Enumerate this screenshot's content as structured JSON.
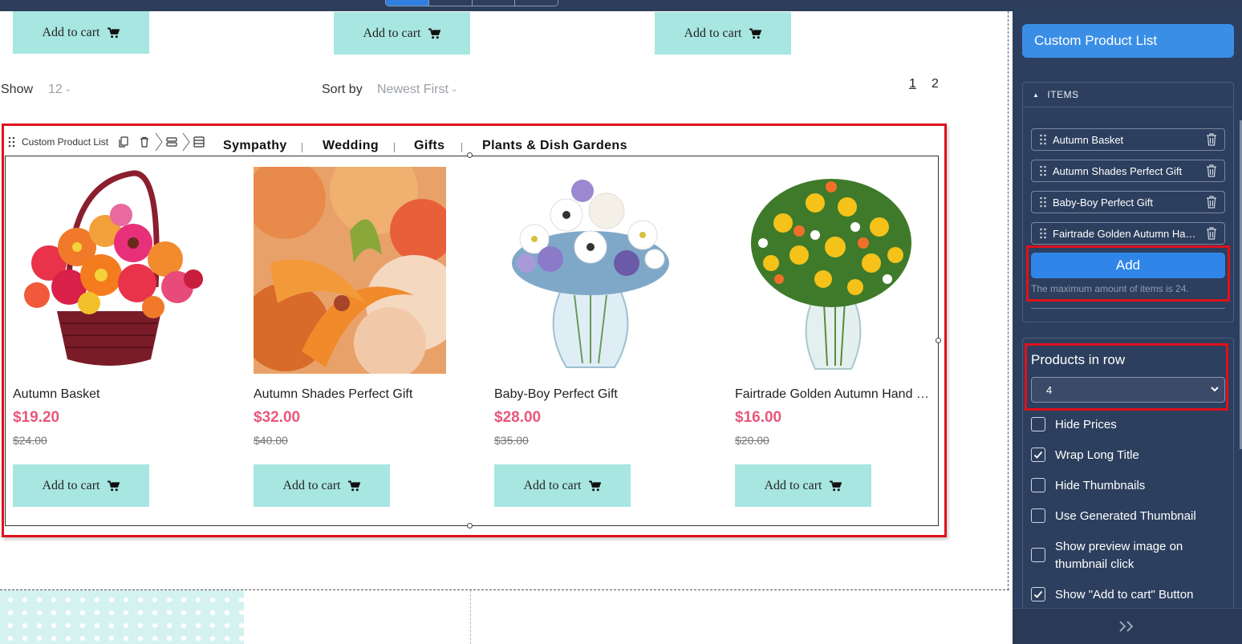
{
  "top_cart_buttons": [
    "Add to cart",
    "Add to cart",
    "Add to cart"
  ],
  "toolbar": {
    "show_label": "Show",
    "show_value": "12",
    "sort_label": "Sort by",
    "sort_value": "Newest First",
    "pages": [
      "1",
      "2"
    ]
  },
  "component": {
    "name": "Custom Product List"
  },
  "categories": [
    "Sympathy",
    "Wedding",
    "Gifts",
    "Plants & Dish Gardens"
  ],
  "products": [
    {
      "title": "Autumn Basket",
      "price": "$19.20",
      "old_price": "$24.00",
      "cta": "Add to cart"
    },
    {
      "title": "Autumn Shades Perfect Gift",
      "price": "$32.00",
      "old_price": "$40.00",
      "cta": "Add to cart"
    },
    {
      "title": "Baby-Boy Perfect Gift",
      "price": "$28.00",
      "old_price": "$35.00",
      "cta": "Add to cart"
    },
    {
      "title": "Fairtrade Golden Autumn Hand tied",
      "price": "$16.00",
      "old_price": "$20.00",
      "cta": "Add to cart"
    }
  ],
  "panel": {
    "title": "Custom Product List",
    "items_heading": "ITEMS",
    "items": [
      "Autumn Basket",
      "Autumn Shades Perfect Gift",
      "Baby-Boy Perfect Gift",
      "Fairtrade Golden Autumn Hand tied"
    ],
    "add_label": "Add",
    "max_note": "The maximum amount of items is 24.",
    "products_in_row_label": "Products in row",
    "products_in_row_value": "4",
    "options": [
      {
        "label": "Hide Prices",
        "checked": false
      },
      {
        "label": "Wrap Long Title",
        "checked": true
      },
      {
        "label": "Hide Thumbnails",
        "checked": false
      },
      {
        "label": "Use Generated Thumbnail",
        "checked": false
      },
      {
        "label": "Show preview image on thumbnail click",
        "checked": false
      },
      {
        "label": "Show \"Add to cart\" Button",
        "checked": true
      }
    ],
    "footer_icon": "double-chevron-right-icon"
  },
  "colors": {
    "cart_button": "#a8e6e1",
    "price": "#e8587a",
    "panel_bg": "#2d3f5e",
    "accent": "#3a8ee6",
    "highlight": "#e0101b"
  }
}
